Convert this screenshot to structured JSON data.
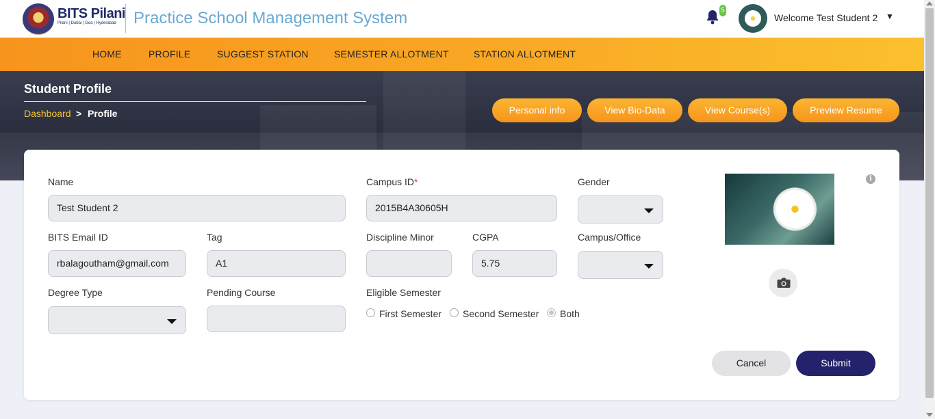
{
  "header": {
    "brand_name": "BITS Pilani",
    "brand_sub": "Pilani | Dubai | Goa | Hyderabad",
    "app_title": "Practice School Management System",
    "notification_count": "5",
    "welcome": "Welcome Test Student 2"
  },
  "nav": [
    "HOME",
    "PROFILE",
    "SUGGEST STATION",
    "SEMESTER ALLOTMENT",
    "STATION ALLOTMENT"
  ],
  "hero": {
    "title": "Student Profile",
    "breadcrumb_root": "Dashboard",
    "breadcrumb_sep": ">",
    "breadcrumb_current": "Profile",
    "buttons": [
      "Personal info",
      "View Bio-Data",
      "View Course(s)",
      "Preview Resume"
    ]
  },
  "form": {
    "name_label": "Name",
    "name_value": "Test Student 2",
    "campus_id_label": "Campus ID",
    "campus_id_required": "*",
    "campus_id_value": "2015B4A30605H",
    "gender_label": "Gender",
    "email_label": "BITS Email ID",
    "email_value": "rbalagoutham@gmail.com",
    "tag_label": "Tag",
    "tag_value": "A1",
    "discipline_minor_label": "Discipline Minor",
    "discipline_minor_value": "",
    "cgpa_label": "CGPA",
    "cgpa_value": "5.75",
    "campus_office_label": "Campus/Office",
    "degree_type_label": "Degree Type",
    "pending_course_label": "Pending Course",
    "pending_course_value": "",
    "eligible_semester_label": "Eligible Semester",
    "semester_options": [
      "First Semester",
      "Second Semester",
      "Both"
    ],
    "semester_selected": "Both",
    "cancel_label": "Cancel",
    "submit_label": "Submit"
  },
  "colors": {
    "nav_gradient_start": "#f7941d",
    "nav_gradient_end": "#fbc02d",
    "submit": "#23226b",
    "breadcrumb_link": "#f7c331",
    "app_title": "#6aa9d2"
  }
}
